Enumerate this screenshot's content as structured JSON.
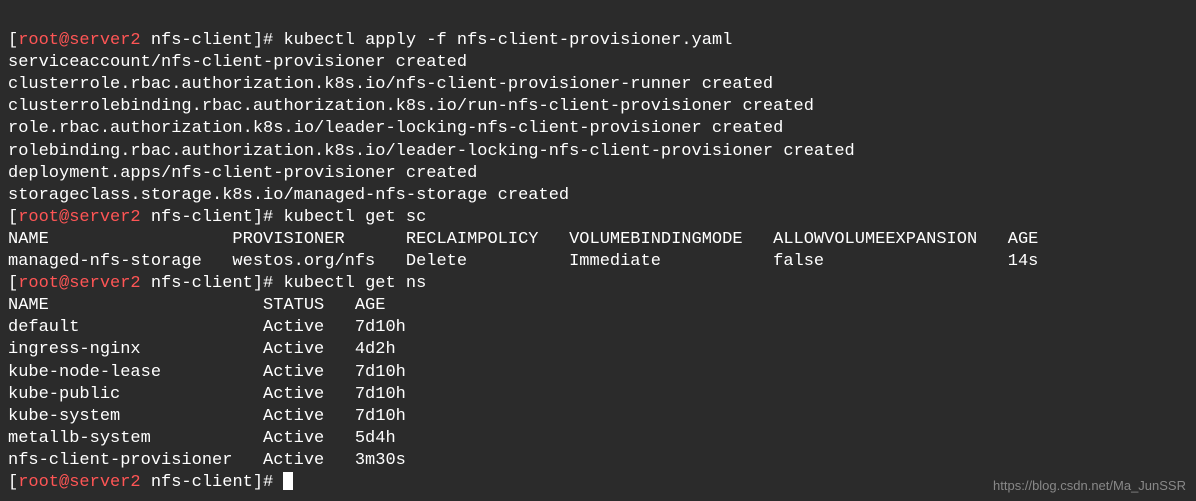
{
  "prompt": {
    "user_host": "root@server2",
    "path": "nfs-client"
  },
  "commands": {
    "cmd1": "kubectl apply -f nfs-client-provisioner.yaml",
    "cmd2": "kubectl get sc",
    "cmd3": "kubectl get ns"
  },
  "apply_output": {
    "line1": "serviceaccount/nfs-client-provisioner created",
    "line2": "clusterrole.rbac.authorization.k8s.io/nfs-client-provisioner-runner created",
    "line3": "clusterrolebinding.rbac.authorization.k8s.io/run-nfs-client-provisioner created",
    "line4": "role.rbac.authorization.k8s.io/leader-locking-nfs-client-provisioner created",
    "line5": "rolebinding.rbac.authorization.k8s.io/leader-locking-nfs-client-provisioner created",
    "line6": "deployment.apps/nfs-client-provisioner created",
    "line7": "storageclass.storage.k8s.io/managed-nfs-storage created"
  },
  "sc_table": {
    "header": "NAME                  PROVISIONER      RECLAIMPOLICY   VOLUMEBINDINGMODE   ALLOWVOLUMEEXPANSION   AGE",
    "row1": "managed-nfs-storage   westos.org/nfs   Delete          Immediate           false                  14s"
  },
  "ns_table": {
    "header": "NAME                     STATUS   AGE",
    "row1": "default                  Active   7d10h",
    "row2": "ingress-nginx            Active   4d2h",
    "row3": "kube-node-lease          Active   7d10h",
    "row4": "kube-public              Active   7d10h",
    "row5": "kube-system              Active   7d10h",
    "row6": "metallb-system           Active   5d4h",
    "row7": "nfs-client-provisioner   Active   3m30s"
  },
  "watermark": "https://blog.csdn.net/Ma_JunSSR"
}
